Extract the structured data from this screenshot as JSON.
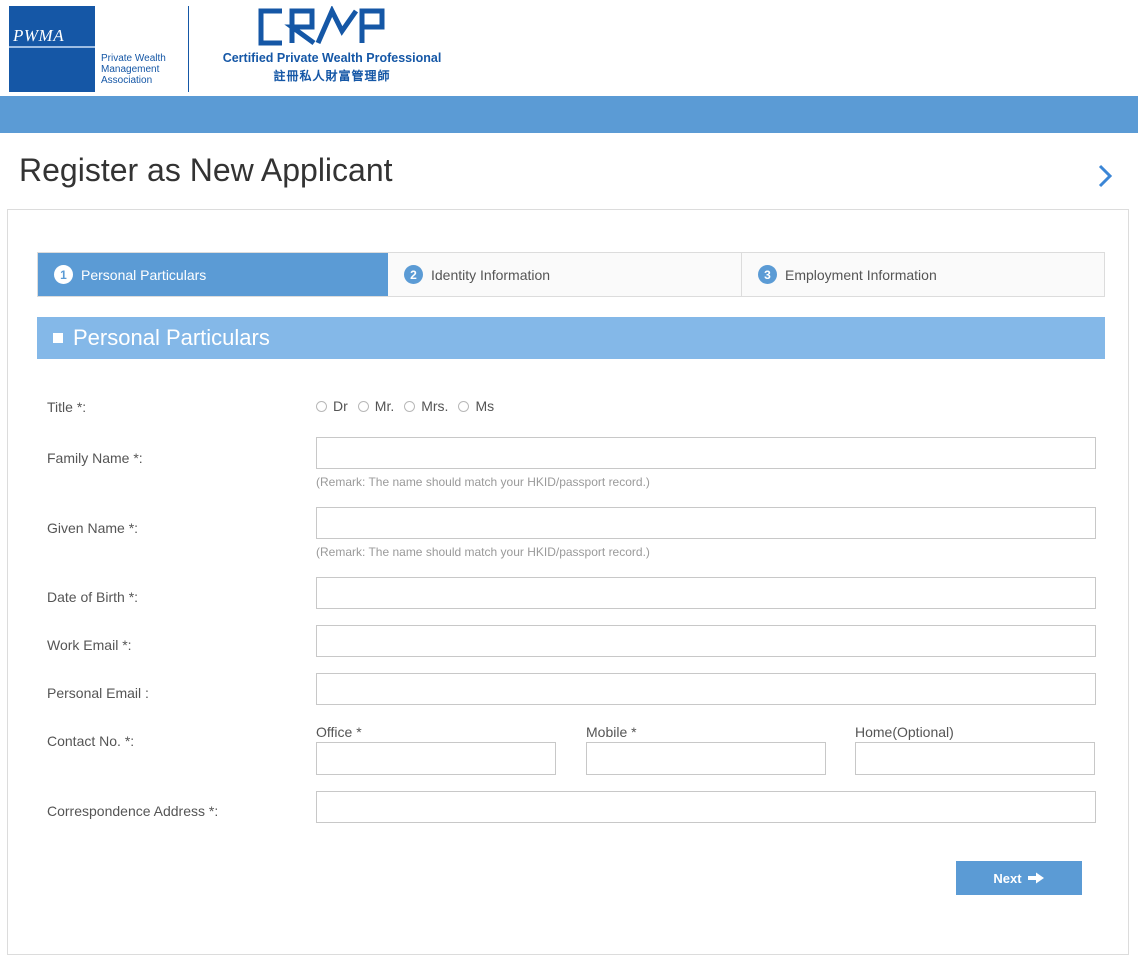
{
  "header": {
    "pwma_abbr": "PWMA",
    "pwma_name_lines": [
      "Private Wealth",
      "Management",
      "Association"
    ],
    "cpwp_mark": "CPWP",
    "cpwp_title": "Certified Private Wealth Professional",
    "cpwp_chinese": "註冊私人財富管理師",
    "brand_color": "#1557a6",
    "band_color": "#5b9bd5"
  },
  "page": {
    "title": "Register as New Applicant"
  },
  "steps": [
    {
      "number": "1",
      "label": "Personal Particulars",
      "active": true
    },
    {
      "number": "2",
      "label": "Identity Information",
      "active": false
    },
    {
      "number": "3",
      "label": "Employment Information",
      "active": false
    }
  ],
  "section": {
    "title": "Personal Particulars"
  },
  "form": {
    "title_label": "Title *:",
    "title_options": [
      "Dr",
      "Mr.",
      "Mrs.",
      "Ms"
    ],
    "family_name_label": "Family Name *:",
    "family_name_value": "",
    "family_name_remark": "(Remark: The name should match your HKID/passport record.)",
    "given_name_label": "Given Name *:",
    "given_name_value": "",
    "given_name_remark": "(Remark: The name should match your HKID/passport record.)",
    "dob_label": "Date of Birth *:",
    "dob_value": "",
    "work_email_label": "Work Email *:",
    "work_email_value": "",
    "personal_email_label": "Personal Email :",
    "personal_email_value": "",
    "contact_label": "Contact No. *:",
    "contact_office_label": "Office *",
    "contact_mobile_label": "Mobile *",
    "contact_home_label": "Home(Optional)",
    "address_label": "Correspondence Address *:",
    "address_value": ""
  },
  "actions": {
    "next_label": "Next"
  },
  "icons": {
    "next_page": "chevron-right-icon",
    "next_button": "arrow-right-icon"
  }
}
